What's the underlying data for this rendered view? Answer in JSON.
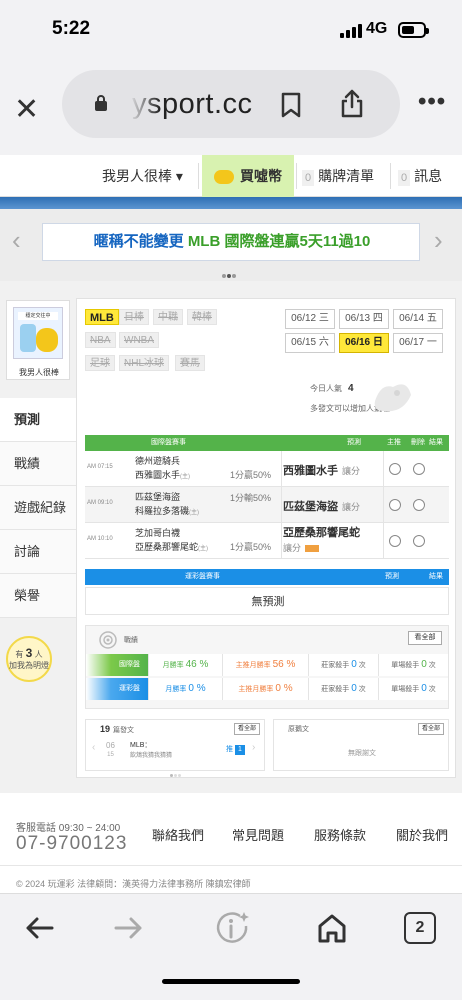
{
  "status": {
    "time": "5:22",
    "network": "4G",
    "battery_level": 0.6
  },
  "browser": {
    "url": "ysport.cc",
    "tabs_count": "2"
  },
  "header": {
    "user_menu": "我男人很棒 ▾",
    "coin_label": "買噓幣",
    "cart_count": "0",
    "cart_label": "購牌清單",
    "msg_count": "0",
    "msg_label": "訊息"
  },
  "banner": {
    "text": "暱稱不能變更 MLB 國際盤連贏5天11過10"
  },
  "colors": {
    "brand_green": "#54b34a",
    "accent_blue": "#1b8fe6",
    "highlight_yellow": "#ffe83a",
    "banner_blue": "#1565c0",
    "banner_green": "#3a9f2a"
  },
  "sidebar": {
    "avatar_name": "我男人很棒",
    "items": [
      {
        "label": "預測"
      },
      {
        "label": "戰績"
      },
      {
        "label": "遊戲紀錄"
      },
      {
        "label": "討論"
      },
      {
        "label": "榮譽"
      }
    ],
    "bulb_prefix": "有",
    "bulb_count": "3",
    "bulb_suffix": "人",
    "bulb_text": "加我為明燈"
  },
  "sports": [
    {
      "label": "MLB",
      "active": true
    },
    {
      "label": "日棒"
    },
    {
      "label": "中職"
    },
    {
      "label": "韓棒"
    },
    {
      "label": "NBA"
    },
    {
      "label": "WNBA"
    },
    {
      "label": "足球"
    },
    {
      "label": "NHL冰球"
    },
    {
      "label": "賽馬"
    }
  ],
  "dates": [
    {
      "label": "06/12 三"
    },
    {
      "label": "06/13 四"
    },
    {
      "label": "06/14 五"
    },
    {
      "label": "06/15 六"
    },
    {
      "label": "06/16 日",
      "active": true
    },
    {
      "label": "06/17 一"
    }
  ],
  "visitors": {
    "label": "今日人氣",
    "count": "4"
  },
  "hint": "多發文可以增加人氣喔～",
  "intl_table": {
    "headers": {
      "game": "國際盤賽事",
      "pick": "預測",
      "home": "主推",
      "del": "刪除",
      "result": "結果"
    },
    "rows": [
      {
        "time": "AM 07:15",
        "team_a": "德州遊騎兵",
        "team_b": "西雅圖水手",
        "mark_b": "(主)",
        "line": "1分贏50%",
        "pick": "西雅圖水手",
        "pick_note": "讓分"
      },
      {
        "time": "AM 09:10",
        "team_a": "匹茲堡海盜",
        "team_b": "科羅拉多落磯",
        "mark_b": "(主)",
        "line_a": "1分輸50%",
        "pick": "匹茲堡海盜",
        "pick_note": "讓分"
      },
      {
        "time": "AM 10:10",
        "team_a": "芝加哥白襪",
        "team_b": "亞歷桑那響尾蛇",
        "mark_b": "(主)",
        "line": "1分贏50%",
        "pick": "亞歷桑那響尾蛇",
        "pick_note": "讓分"
      }
    ]
  },
  "lottery_table": {
    "headers": {
      "game": "運彩盤賽事",
      "pick": "預測",
      "result": "結果"
    },
    "empty": "無預測"
  },
  "stats": {
    "title": "戰績",
    "all_button": "看全部",
    "rows": [
      {
        "label": "國際盤",
        "month_rate_label": "月勝率",
        "month_rate": "46 %",
        "main_rate_label": "主推月勝率",
        "main_rate": "56 %",
        "banker_label": "莊家殺手",
        "banker": "0",
        "unit": "次",
        "single_label": "單場殺手",
        "single": "0",
        "unit2": "次"
      },
      {
        "label": "運彩盤",
        "month_rate_label": "月勝率",
        "month_rate": "0 %",
        "main_rate_label": "主推月勝率",
        "main_rate": "0 %",
        "banker_label": "莊家殺手",
        "banker": "0",
        "unit": "次",
        "single_label": "單場殺手",
        "single": "0",
        "unit2": "次"
      }
    ]
  },
  "posts": {
    "count": "19",
    "label": "篇發文",
    "all_button": "看全部",
    "date_top": "06",
    "date_bottom": "15",
    "league": "MLB：",
    "text": "飲鴆我猜我猜猜",
    "bet_label": "推",
    "bet_num": "1"
  },
  "replies": {
    "title": "原鵝文",
    "all_button": "看全部",
    "empty": "無跟謝文"
  },
  "footer": {
    "service_label": "客服電話 09:30 ~ 24:00",
    "phone": "07-9700123",
    "links": [
      "聯絡我們",
      "常見問題",
      "服務條款",
      "關於我們"
    ],
    "copyright": "© 2024 玩運彩 法律顧問：漢英得力法律事務所 陳鎮宏律師"
  }
}
